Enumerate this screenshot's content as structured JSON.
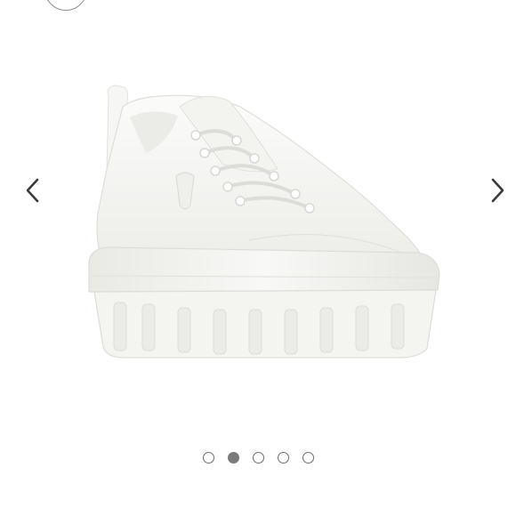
{
  "viewer": {
    "image": {
      "subject": "white-chunky-platform-sneaker",
      "background_color": "#ffffff",
      "shoe_color": "#f7f7f5",
      "shadow_color": "#e4e4e0"
    },
    "navigation": {
      "prev_icon": "chevron-left-icon",
      "next_icon": "chevron-right-icon",
      "arrow_color": "#3a3a3a"
    },
    "pagination": {
      "total": 5,
      "active_index": 1,
      "active_color": "#7a7a7a",
      "inactive_border": "#6f6f6f"
    },
    "top_control": {
      "icon": "circle-button-icon"
    }
  }
}
